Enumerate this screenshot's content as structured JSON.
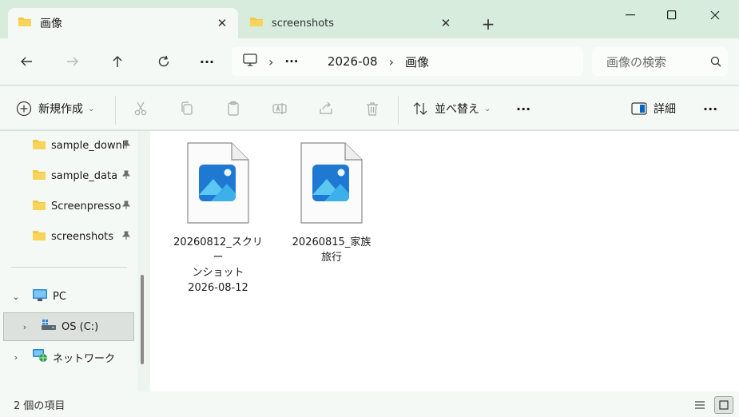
{
  "tabs": [
    {
      "title": "画像",
      "icon": "folder-icon"
    },
    {
      "title": "screenshots",
      "icon": "folder-icon"
    }
  ],
  "window_controls": {
    "minimize": "—",
    "maximize": "☐",
    "close": "✕"
  },
  "nav": {
    "ellipsis": "···"
  },
  "address": {
    "segments": [
      "2026-08",
      "画像"
    ],
    "overflow": "···"
  },
  "search": {
    "placeholder": "画像の検索"
  },
  "toolbar": {
    "new_label": "新規作成",
    "sort_label": "並べ替え",
    "more": "···",
    "details_label": "詳細",
    "overflow": "···"
  },
  "sidebar": {
    "quick_access": [
      {
        "label": "sample_downl",
        "pinned": true
      },
      {
        "label": "sample_data",
        "pinned": true
      },
      {
        "label": "Screenpresso",
        "pinned": true
      },
      {
        "label": "screenshots",
        "pinned": true
      }
    ],
    "pc_label": "PC",
    "drive_label": "OS (C:)",
    "network_label": "ネットワーク"
  },
  "files": [
    {
      "name_line1": "20260812_スクリー",
      "name_line2": "ンショット",
      "name_line3": "2026-08-12"
    },
    {
      "name_line1": "20260815_家族",
      "name_line2": "旅行",
      "name_line3": ""
    }
  ],
  "status": {
    "item_count": "2 個の項目"
  },
  "colors": {
    "accent": "#0067c0",
    "folder": "#f6c745",
    "titlebar": "#d7ecdd",
    "surface": "#f4f9f5"
  }
}
